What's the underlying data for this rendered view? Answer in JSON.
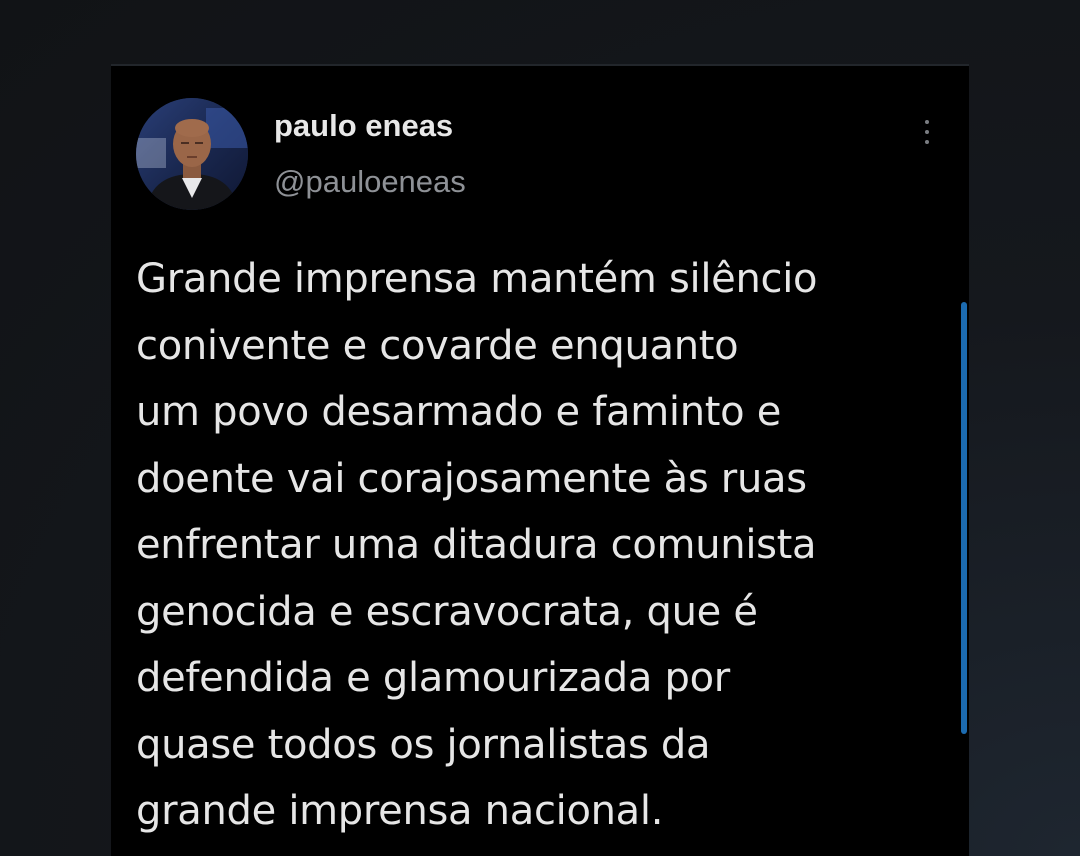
{
  "tweet": {
    "author": {
      "display_name": "paulo eneas",
      "handle": "@pauloeneas"
    },
    "menu_icon": "more-vertical-icon",
    "text_lines": [
      "Grande imprensa mantém silêncio",
      "conivente e covarde enquanto",
      "um povo desarmado e faminto e",
      "doente vai corajosamente às ruas",
      "enfrentar uma ditadura comunista",
      "genocida e escravocrata, que é",
      "defendida e glamourizada por",
      "quase todos os jornalistas da",
      "grande imprensa nacional."
    ]
  },
  "colors": {
    "background": "#000000",
    "text": "#e6e6e6",
    "handle": "#8e9196",
    "scrollbar": "#1c6bb0"
  }
}
